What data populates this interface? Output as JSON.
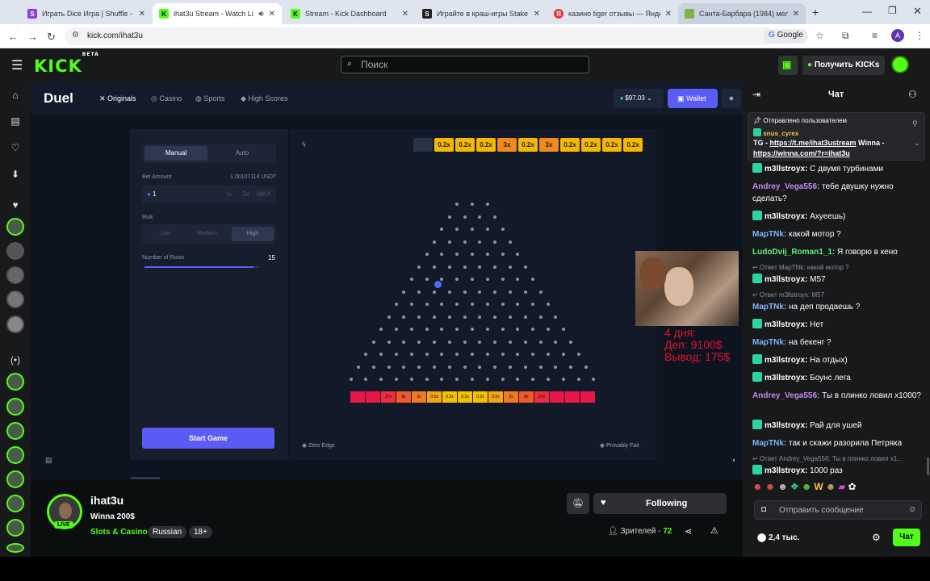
{
  "browser": {
    "tabs": [
      {
        "title": "Играть Dice Игра | Shuffle - VIP",
        "color": "#8b3cf0",
        "letter": "S"
      },
      {
        "title": "ihat3u Stream - Watch Live",
        "color": "#53fc18",
        "letter": "K"
      },
      {
        "title": "Stream - Kick Dashboard",
        "color": "#53fc18",
        "letter": "K"
      },
      {
        "title": "Играйте в краш-игры Stake O",
        "color": "#222222",
        "letter": "S"
      },
      {
        "title": "казино tiger отзывы — Яндекс",
        "color": "#e53935",
        "letter": "Я"
      },
      {
        "title": "Санта-Барбара (1984) мелодр",
        "color": "#7cb342",
        "letter": ""
      }
    ],
    "url": "kick.com/ihat3u",
    "google_label": "Google",
    "profile_letter": "A"
  },
  "kick": {
    "logo": "KICK",
    "beta": "BETA",
    "search_placeholder": "Поиск",
    "get_kicks": "Получить KICKs"
  },
  "duel": {
    "logo": "Duel",
    "nav": [
      "Originals",
      "Casino",
      "Sports",
      "High Scores"
    ],
    "balance": "$97.03",
    "wallet": "Wallet",
    "modes": [
      "Manual",
      "Auto"
    ],
    "bet_amount_label": "Bet Amount",
    "bet_amount_value": "1.00107114 USDT",
    "bet_input": "1",
    "bet_buttons": [
      "½",
      "2x",
      "MAX"
    ],
    "risk_label": "Risk",
    "risks": [
      "Low",
      "Medium",
      "High"
    ],
    "rows_label": "Number of Rows",
    "rows_value": "15",
    "rows_fraction": 0.95,
    "start": "Start Game",
    "zero_edge": "Zero Edge",
    "provably_fair": "Provably Fair",
    "history": [
      "",
      "0.2x",
      "0.2x",
      "0.2x",
      "3x",
      "0.2x",
      "3x",
      "0.2x",
      "0.2x",
      "0.2x",
      "0.2x"
    ],
    "slots": [
      "",
      "",
      "27x",
      "8x",
      "3x",
      "0.5x",
      "0.2x",
      "0.2x",
      "0.2x",
      "0.5x",
      "3x",
      "8x",
      "27x",
      "",
      "",
      ""
    ],
    "overlay_lines": [
      "4 дня:",
      "Деп: 9100$",
      "Вывод: 175$"
    ]
  },
  "streamer": {
    "name": "ihat3u",
    "title": "Winna 200$",
    "category": "Slots & Casino",
    "tags": [
      "Russian",
      "18+"
    ],
    "live": "LIVE",
    "following": "Following",
    "viewers_label": "Зрителей -",
    "viewers": "72"
  },
  "chat": {
    "title": "Чат",
    "pinned_label": "Отправлено пользователем",
    "pinned_user": "snus_cyrex",
    "pinned_text_prefix": "TG - ",
    "pinned_link1": "https://t.me/ihat3ustream",
    "pinned_mid": " Winna - ",
    "pinned_link2": "https://winna.com/?r=ihat3u",
    "messages": [
      {
        "user": "m3llstroyx",
        "color": "#ffffff",
        "badge": true,
        "text": "С двумя турбинами"
      },
      {
        "user": "Andrey_Vega556",
        "color": "#c38bf0",
        "badge": false,
        "text": "тебе двушку нужно сделать?"
      },
      {
        "user": "m3llstroyx",
        "color": "#ffffff",
        "badge": true,
        "text": "Ахуеешь)"
      },
      {
        "user": "MapTNk",
        "color": "#7fb4ff",
        "badge": false,
        "text": "какой мотор ?"
      },
      {
        "user": "LudoDvij_Roman1_1",
        "color": "#5cf074",
        "badge": false,
        "text": "Я говорю в кено"
      },
      {
        "user": "m3llstroyx",
        "color": "#ffffff",
        "badge": true,
        "text": "M57",
        "reply": "Ответ MapTNk: какой мотор ?"
      },
      {
        "user": "MapTNk",
        "color": "#7fb4ff",
        "badge": false,
        "text": "на деп продаешь ?",
        "reply": "Ответ m3llstroyx: M57"
      },
      {
        "user": "m3llstroyx",
        "color": "#ffffff",
        "badge": true,
        "text": "Нет"
      },
      {
        "user": "MapTNk",
        "color": "#7fb4ff",
        "badge": false,
        "text": "на бекенг ?"
      },
      {
        "user": "m3llstroyx",
        "color": "#ffffff",
        "badge": true,
        "text": "На отдых)"
      },
      {
        "user": "m3llstroyx",
        "color": "#ffffff",
        "badge": true,
        "text": "Боунс лега"
      },
      {
        "user": "Andrey_Vega556",
        "color": "#c38bf0",
        "badge": false,
        "text": "Ты в плинко ловил х1000?"
      },
      {
        "user": "m3llstroyx",
        "color": "#ffffff",
        "badge": true,
        "text": "Рай для ушей"
      },
      {
        "user": "MapTNk",
        "color": "#7fb4ff",
        "badge": false,
        "text": "так и скажи разорила Петряка"
      },
      {
        "user": "m3llstroyx",
        "color": "#ffffff",
        "badge": true,
        "text": "1000 раз",
        "reply": "Ответ Andrey_Vega556: Ты в плинко ловил х1..."
      }
    ],
    "input_placeholder": "Отправить сообщение",
    "followers": "2,4 тыс.",
    "send": "Чат"
  }
}
